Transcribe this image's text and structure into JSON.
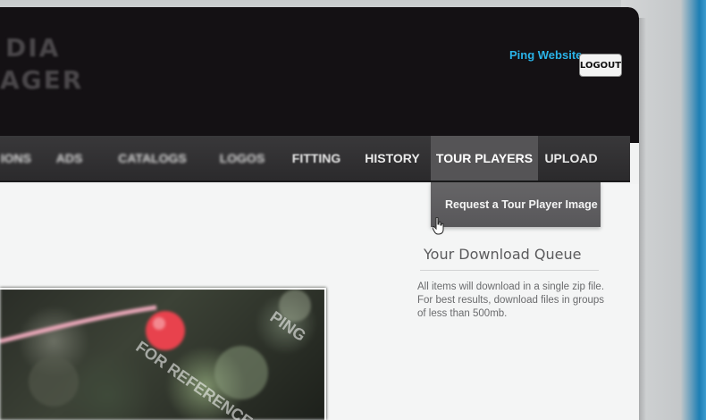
{
  "header": {
    "logo_line1": "DIA",
    "logo_line2": "AGER",
    "website_link": "Ping Website",
    "logout_label": "LOGOUT"
  },
  "nav": {
    "items": [
      {
        "label": "IONS"
      },
      {
        "label": "ADS"
      },
      {
        "label": "CATALOGS"
      },
      {
        "label": "LOGOS"
      },
      {
        "label": "FITTING"
      },
      {
        "label": "HISTORY"
      },
      {
        "label": "TOUR PLAYERS",
        "active": true
      },
      {
        "label": "UPLOAD"
      }
    ],
    "dropdown_item": "Request a Tour Player Image"
  },
  "queue": {
    "title": "Your Download Queue",
    "description": "All items will download in a single zip file. For best results, download files in groups of less than 500mb."
  },
  "photo": {
    "watermark": "PING",
    "watermark2": "FOR REFERENCE"
  },
  "colors": {
    "header_bg": "#141114",
    "nav_bg": "#2f2e30",
    "link": "#2ab3e8",
    "active_tab": "#555456"
  }
}
